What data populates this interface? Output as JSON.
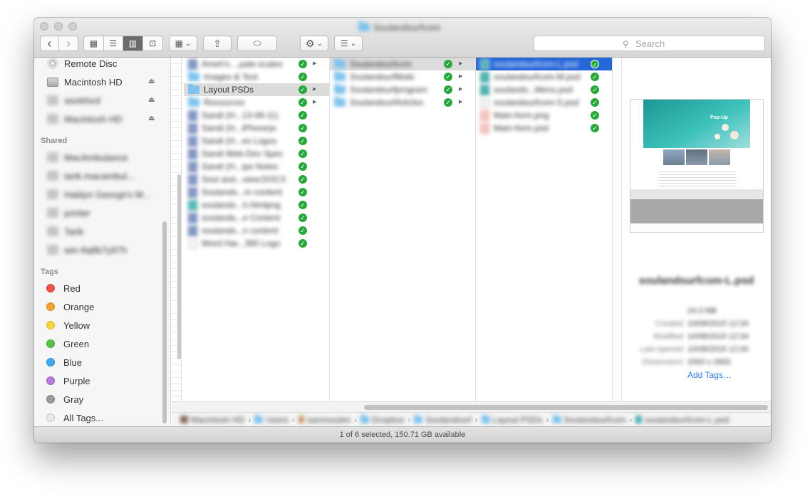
{
  "window": {
    "title": "Soulandsurfcom",
    "title_icon": "folder-icon"
  },
  "toolbar": {
    "back_icon": "chevron-left-icon",
    "forward_icon": "chevron-right-icon",
    "view_icons": [
      "icon-view-icon",
      "list-view-icon",
      "column-view-icon",
      "cover-flow-icon"
    ],
    "arrange_icon": "arrange-grid-icon",
    "share_icon": "share-icon",
    "tag_icon": "tag-icon",
    "action_icon": "gear-icon",
    "dropbox_icon": "dropbox-icon",
    "search_placeholder": "Search",
    "glyphs": {
      "back": "‹",
      "forward": "›",
      "view_icon": "▦",
      "view_list": "☰",
      "view_column": "▥",
      "view_coverflow": "⊡",
      "arrange": "▦",
      "caret": "⌄",
      "share": "⇪",
      "tag": "⬭",
      "gear": "⚙",
      "list": "☰",
      "search": "⚲"
    }
  },
  "sidebar": {
    "devices": [
      {
        "label": "Remote Disc",
        "icon": "disc-icon",
        "eject": false
      },
      {
        "label": "Macintosh HD",
        "icon": "hard-drive-icon",
        "eject": true
      },
      {
        "label": "storkford",
        "icon": "hard-drive-icon",
        "eject": true
      },
      {
        "label": "Macintosh HD",
        "icon": "hard-drive-icon",
        "eject": true
      }
    ],
    "shared_heading": "Shared",
    "shared": [
      {
        "label": "MacAmbulance",
        "icon": "network-icon",
        "eject": true
      },
      {
        "label": "tarik.macambul...",
        "icon": "computer-icon",
        "eject": true
      },
      {
        "label": "Haldyn George's M...",
        "icon": "display-icon",
        "eject": false
      },
      {
        "label": "printer",
        "icon": "computer-icon",
        "eject": false
      },
      {
        "label": "Tarik",
        "icon": "computer-icon",
        "eject": false
      },
      {
        "label": "win-8q8b7y97h",
        "icon": "computer-icon",
        "eject": false
      }
    ],
    "tags_heading": "Tags",
    "tags": [
      {
        "label": "Red",
        "color": "#f0524a"
      },
      {
        "label": "Orange",
        "color": "#f3a234"
      },
      {
        "label": "Yellow",
        "color": "#f6d63e"
      },
      {
        "label": "Green",
        "color": "#5ac24a"
      },
      {
        "label": "Blue",
        "color": "#3fa8f0"
      },
      {
        "label": "Purple",
        "color": "#b67ad8"
      },
      {
        "label": "Gray",
        "color": "#9b9b9b"
      },
      {
        "label": "All Tags...",
        "color": "#e0e0e0"
      }
    ],
    "eject_glyph": "⏏"
  },
  "columns": {
    "col1": [
      {
        "label": "Ameh's ...pale-scales",
        "kind": "doc",
        "blur": true,
        "folder": false
      },
      {
        "label": "Images & Text",
        "kind": "folder",
        "blur": true,
        "folder": true
      },
      {
        "label": "Layout PSDs",
        "kind": "folder",
        "blur": false,
        "folder": true,
        "selected": true
      },
      {
        "label": "Resources",
        "kind": "folder",
        "blur": true,
        "folder": true
      },
      {
        "label": "Sandi (H...13-08-11)",
        "kind": "doc",
        "blur": true,
        "folder": false
      },
      {
        "label": "Sandi (H...iPhone)e",
        "kind": "doc",
        "blur": true,
        "folder": false
      },
      {
        "label": "Sandi (H...es Logos",
        "kind": "doc",
        "blur": true,
        "folder": false
      },
      {
        "label": "Sandi Web-Dev Spec",
        "kind": "doc",
        "blur": true,
        "folder": false
      },
      {
        "label": "Sandi (H...ipe Notes",
        "kind": "doc",
        "blur": true,
        "folder": false
      },
      {
        "label": "Soul and...view.DOCX",
        "kind": "doc",
        "blur": true,
        "folder": false
      },
      {
        "label": "Soulands...m content",
        "kind": "doc",
        "blur": true,
        "folder": false
      },
      {
        "label": "soulands...h.htmlpng",
        "kind": "img",
        "blur": true,
        "folder": false
      },
      {
        "label": "soulands...e Content",
        "kind": "doc",
        "blur": true,
        "folder": false
      },
      {
        "label": "soulands...n content",
        "kind": "doc",
        "blur": true,
        "folder": false
      },
      {
        "label": "Word Har...360 Logo",
        "kind": "blank",
        "blur": true,
        "folder": false
      }
    ],
    "col2": [
      {
        "label": "Soulandsurfcom",
        "kind": "folder",
        "selected": true
      },
      {
        "label": "SoulandsurfMobi",
        "kind": "folder"
      },
      {
        "label": "Soulandsurfprogram",
        "kind": "folder"
      },
      {
        "label": "SoulandsurfArticles",
        "kind": "folder"
      }
    ],
    "col3": [
      {
        "label": "soulandsurfcom-L.psd",
        "kind": "img",
        "selected": true
      },
      {
        "label": "soulandsurfcom-M.psd",
        "kind": "img"
      },
      {
        "label": "soulands...Menu.psd",
        "kind": "img"
      },
      {
        "label": "soulandsurfcom-S.psd",
        "kind": "blank"
      },
      {
        "label": "Main-form.png",
        "kind": "png"
      },
      {
        "label": "Main-form.psd",
        "kind": "png"
      }
    ],
    "check_glyph": "✓",
    "arrow_glyph": "▶",
    "handle_glyph": "ǁ"
  },
  "preview": {
    "filename": "soulandsurfcom-L.psd",
    "size": "24.3 MB",
    "meta": [
      {
        "label": "Created",
        "value": "10/08/2015 12:34"
      },
      {
        "label": "Modified",
        "value": "10/08/2015 12:34"
      },
      {
        "label": "Last opened",
        "value": "10/08/2015 12:34"
      },
      {
        "label": "Dimensions",
        "value": "2000 x 2800"
      }
    ],
    "add_tags": "Add Tags…",
    "hero_text": "Pop-Up",
    "brand_color": "#2aa6a4"
  },
  "pathbar": [
    {
      "label": "Macintosh HD",
      "icon": "hard-drive-icon"
    },
    {
      "label": "Users",
      "icon": "folder-icon"
    },
    {
      "label": "sannsoulen",
      "icon": "home-icon"
    },
    {
      "label": "Dropbox",
      "icon": "folder-icon"
    },
    {
      "label": "Soulandsurf",
      "icon": "folder-icon"
    },
    {
      "label": "Layout PSDs",
      "icon": "folder-icon"
    },
    {
      "label": "Soulandsurfcom",
      "icon": "folder-icon"
    },
    {
      "label": "soulandsurfcom-L.psd",
      "icon": "file-icon"
    }
  ],
  "path_separator": "›",
  "status": "1 of 6 selected, 150.71 GB available"
}
